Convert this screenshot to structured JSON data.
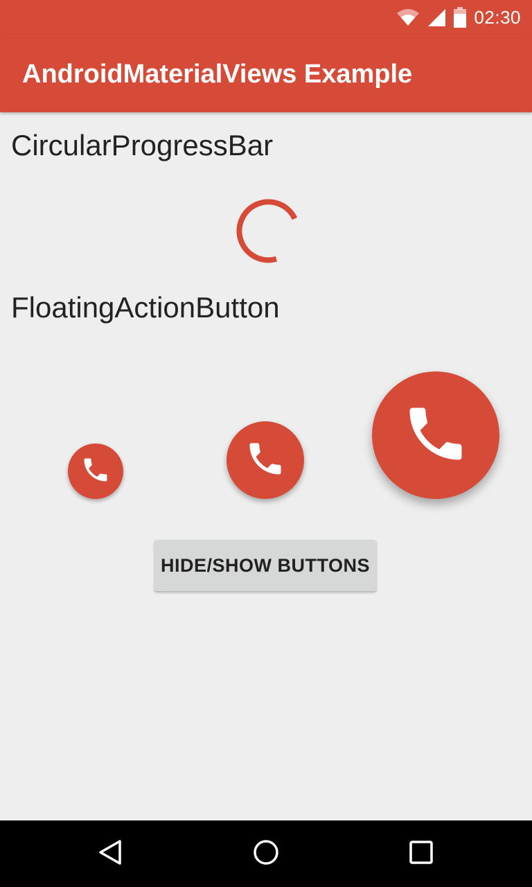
{
  "status_bar": {
    "time": "02:30",
    "icons": [
      "wifi-icon",
      "signal-icon",
      "battery-icon"
    ],
    "background_color": "#d64a38"
  },
  "app_bar": {
    "title": "AndroidMaterialViews Example",
    "background_color": "#d64a38"
  },
  "sections": {
    "progress_heading": "CircularProgressBar",
    "fab_heading": "FloatingActionButton"
  },
  "progress": {
    "icon": "circular-progress-spinner",
    "color": "#d64a38"
  },
  "fabs": [
    {
      "size": "small",
      "icon": "phone-icon"
    },
    {
      "size": "medium",
      "icon": "phone-icon"
    },
    {
      "size": "large",
      "icon": "phone-icon"
    }
  ],
  "toggle_button": {
    "label": "HIDE/SHOW BUTTONS"
  },
  "nav_bar": {
    "icons": [
      "back-icon",
      "home-icon",
      "recents-icon"
    ]
  },
  "colors": {
    "accent": "#d64a38",
    "background": "#eeeeee",
    "button": "#d6d7d7"
  }
}
